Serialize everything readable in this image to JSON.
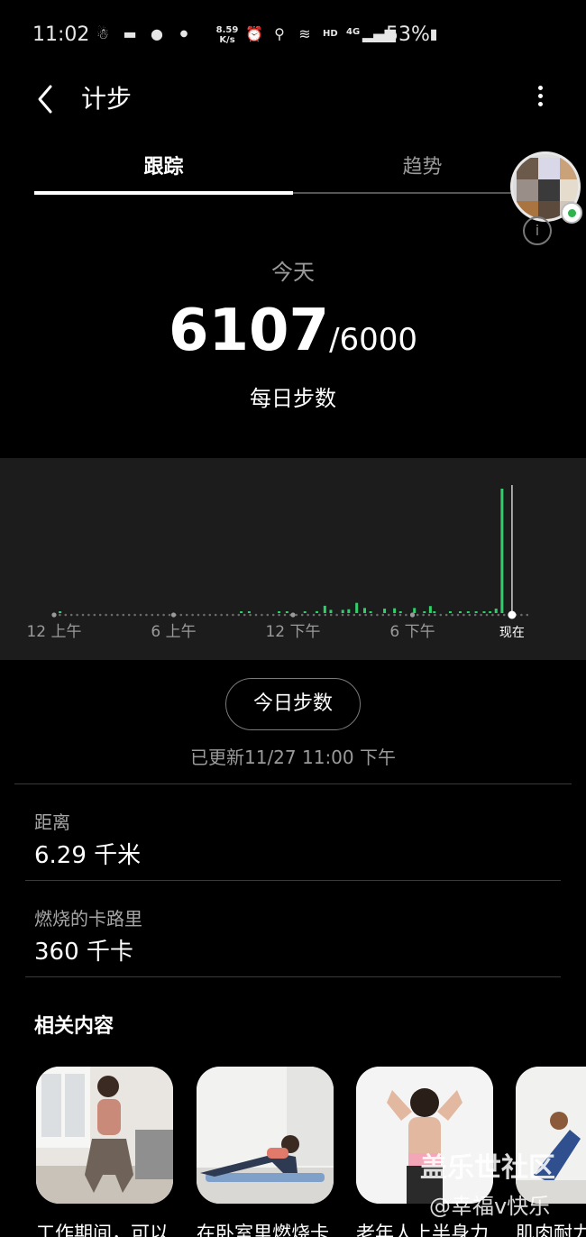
{
  "status_bar": {
    "time": "11:02",
    "net_speed_value": "8.59",
    "net_speed_unit": "K/s",
    "network_label": "HD",
    "signal_label": "4G",
    "battery": "53%"
  },
  "app_bar": {
    "title": "计步"
  },
  "tabs": [
    {
      "label": "跟踪",
      "selected": true
    },
    {
      "label": "趋势",
      "selected": false
    }
  ],
  "summary": {
    "period_label": "今天",
    "steps": "6107",
    "goal": "/6000",
    "caption": "每日步数"
  },
  "chart_data": {
    "type": "bar",
    "x_tick_labels": [
      "12 上午",
      "6 上午",
      "12 下午",
      "6 下午",
      "现在"
    ],
    "bar_color": "#2fd06a",
    "hour_range": [
      0,
      24
    ],
    "current_hour": 23.0,
    "series": [
      {
        "hours": [
          0.3,
          9.4,
          9.8,
          11.3,
          11.7,
          12.6,
          13.2,
          13.6,
          13.9,
          14.5,
          14.8,
          15.2,
          15.6,
          15.9,
          16.6,
          17.1,
          17.4,
          18.1,
          18.6,
          18.9,
          19.1,
          19.9,
          20.4,
          20.8,
          21.2,
          21.6,
          21.9,
          22.2,
          22.5,
          22.8
        ],
        "steps": [
          40,
          15,
          15,
          25,
          15,
          25,
          60,
          230,
          100,
          100,
          120,
          320,
          160,
          25,
          140,
          150,
          25,
          160,
          20,
          220,
          20,
          25,
          40,
          40,
          40,
          30,
          40,
          140,
          3900,
          0
        ]
      }
    ]
  },
  "today_steps_button": "今日步数",
  "updated": "已更新11/27 11:00 下午",
  "stats": [
    {
      "label": "距离",
      "value": "6.29 千米"
    },
    {
      "label": "燃烧的卡路里",
      "value": "360 千卡"
    }
  ],
  "related": {
    "title": "相关内容",
    "cards": [
      {
        "title": "工作期间，可以"
      },
      {
        "title": "在卧室里燃烧卡"
      },
      {
        "title": "老年人上半身力"
      },
      {
        "title": "肌肉耐力"
      }
    ]
  },
  "watermark": {
    "line1": "盖乐世社区",
    "line2": "@幸福v快乐"
  },
  "colors": {
    "accent": "#2fd06a",
    "background": "#000000",
    "panel": "#1c1c1c"
  }
}
